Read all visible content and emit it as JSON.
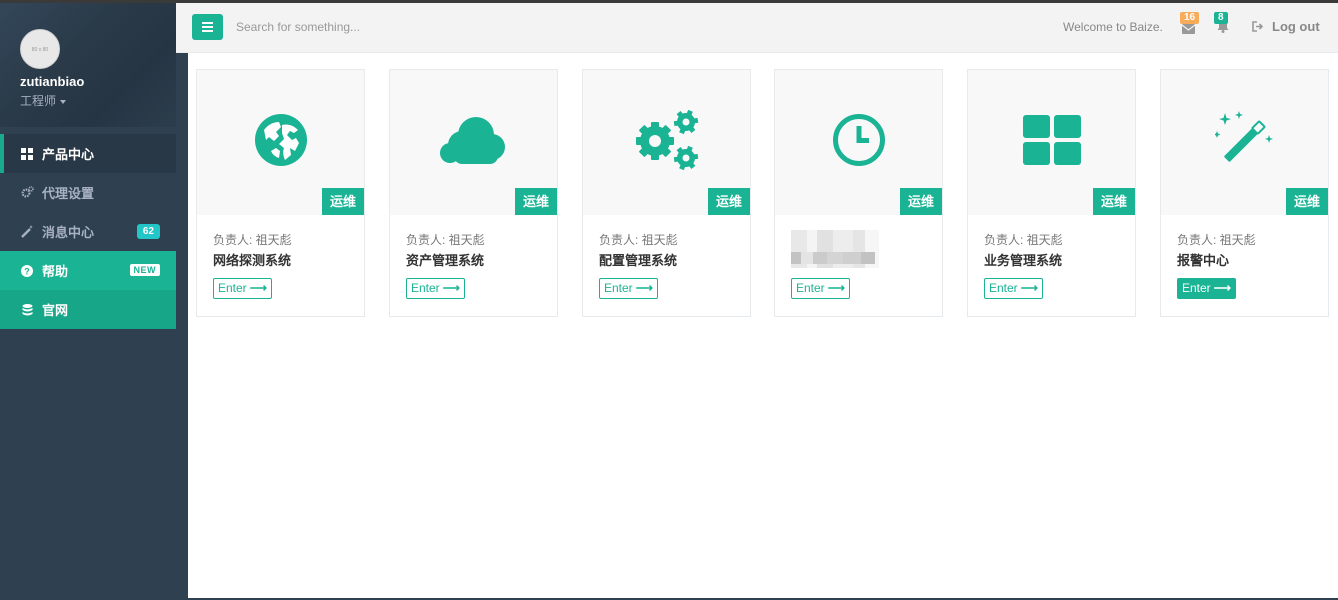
{
  "profile": {
    "avatar_text": "80 x 80",
    "username": "zutianbiao",
    "role": "工程师"
  },
  "sidebar": {
    "items": [
      {
        "label": "产品中心",
        "icon": "grid-icon"
      },
      {
        "label": "代理设置",
        "icon": "gears-icon"
      },
      {
        "label": "消息中心",
        "icon": "magic-icon",
        "badge": "62"
      },
      {
        "label": "帮助",
        "icon": "question-icon",
        "badge": "NEW"
      },
      {
        "label": "官网",
        "icon": "database-icon"
      }
    ]
  },
  "topbar": {
    "search_placeholder": "Search for something...",
    "welcome": "Welcome to Baize.",
    "mail_count": "16",
    "bell_count": "8",
    "logout": "Log out"
  },
  "cards": [
    {
      "icon": "globe-icon",
      "tag": "运维",
      "owner": "负责人: 祖天彪",
      "name": "网络探测系统",
      "enter": "Enter"
    },
    {
      "icon": "cloud-icon",
      "tag": "运维",
      "owner": "负责人: 祖天彪",
      "name": "资产管理系统",
      "enter": "Enter"
    },
    {
      "icon": "gears-icon",
      "tag": "运维",
      "owner": "负责人: 祖天彪",
      "name": "配置管理系统",
      "enter": "Enter"
    },
    {
      "icon": "clock-icon",
      "tag": "运维",
      "owner": "",
      "name": "",
      "enter": "Enter"
    },
    {
      "icon": "th-large-icon",
      "tag": "运维",
      "owner": "负责人: 祖天彪",
      "name": "业务管理系统",
      "enter": "Enter"
    },
    {
      "icon": "magic-icon",
      "tag": "运维",
      "owner": "负责人: 祖天彪",
      "name": "报警中心",
      "enter": "Enter"
    }
  ],
  "colors": {
    "accent": "#1ab394",
    "sidebar": "#2f4050",
    "badge_mail": "#f8ac59",
    "badge_cyan": "#23c6c8"
  }
}
